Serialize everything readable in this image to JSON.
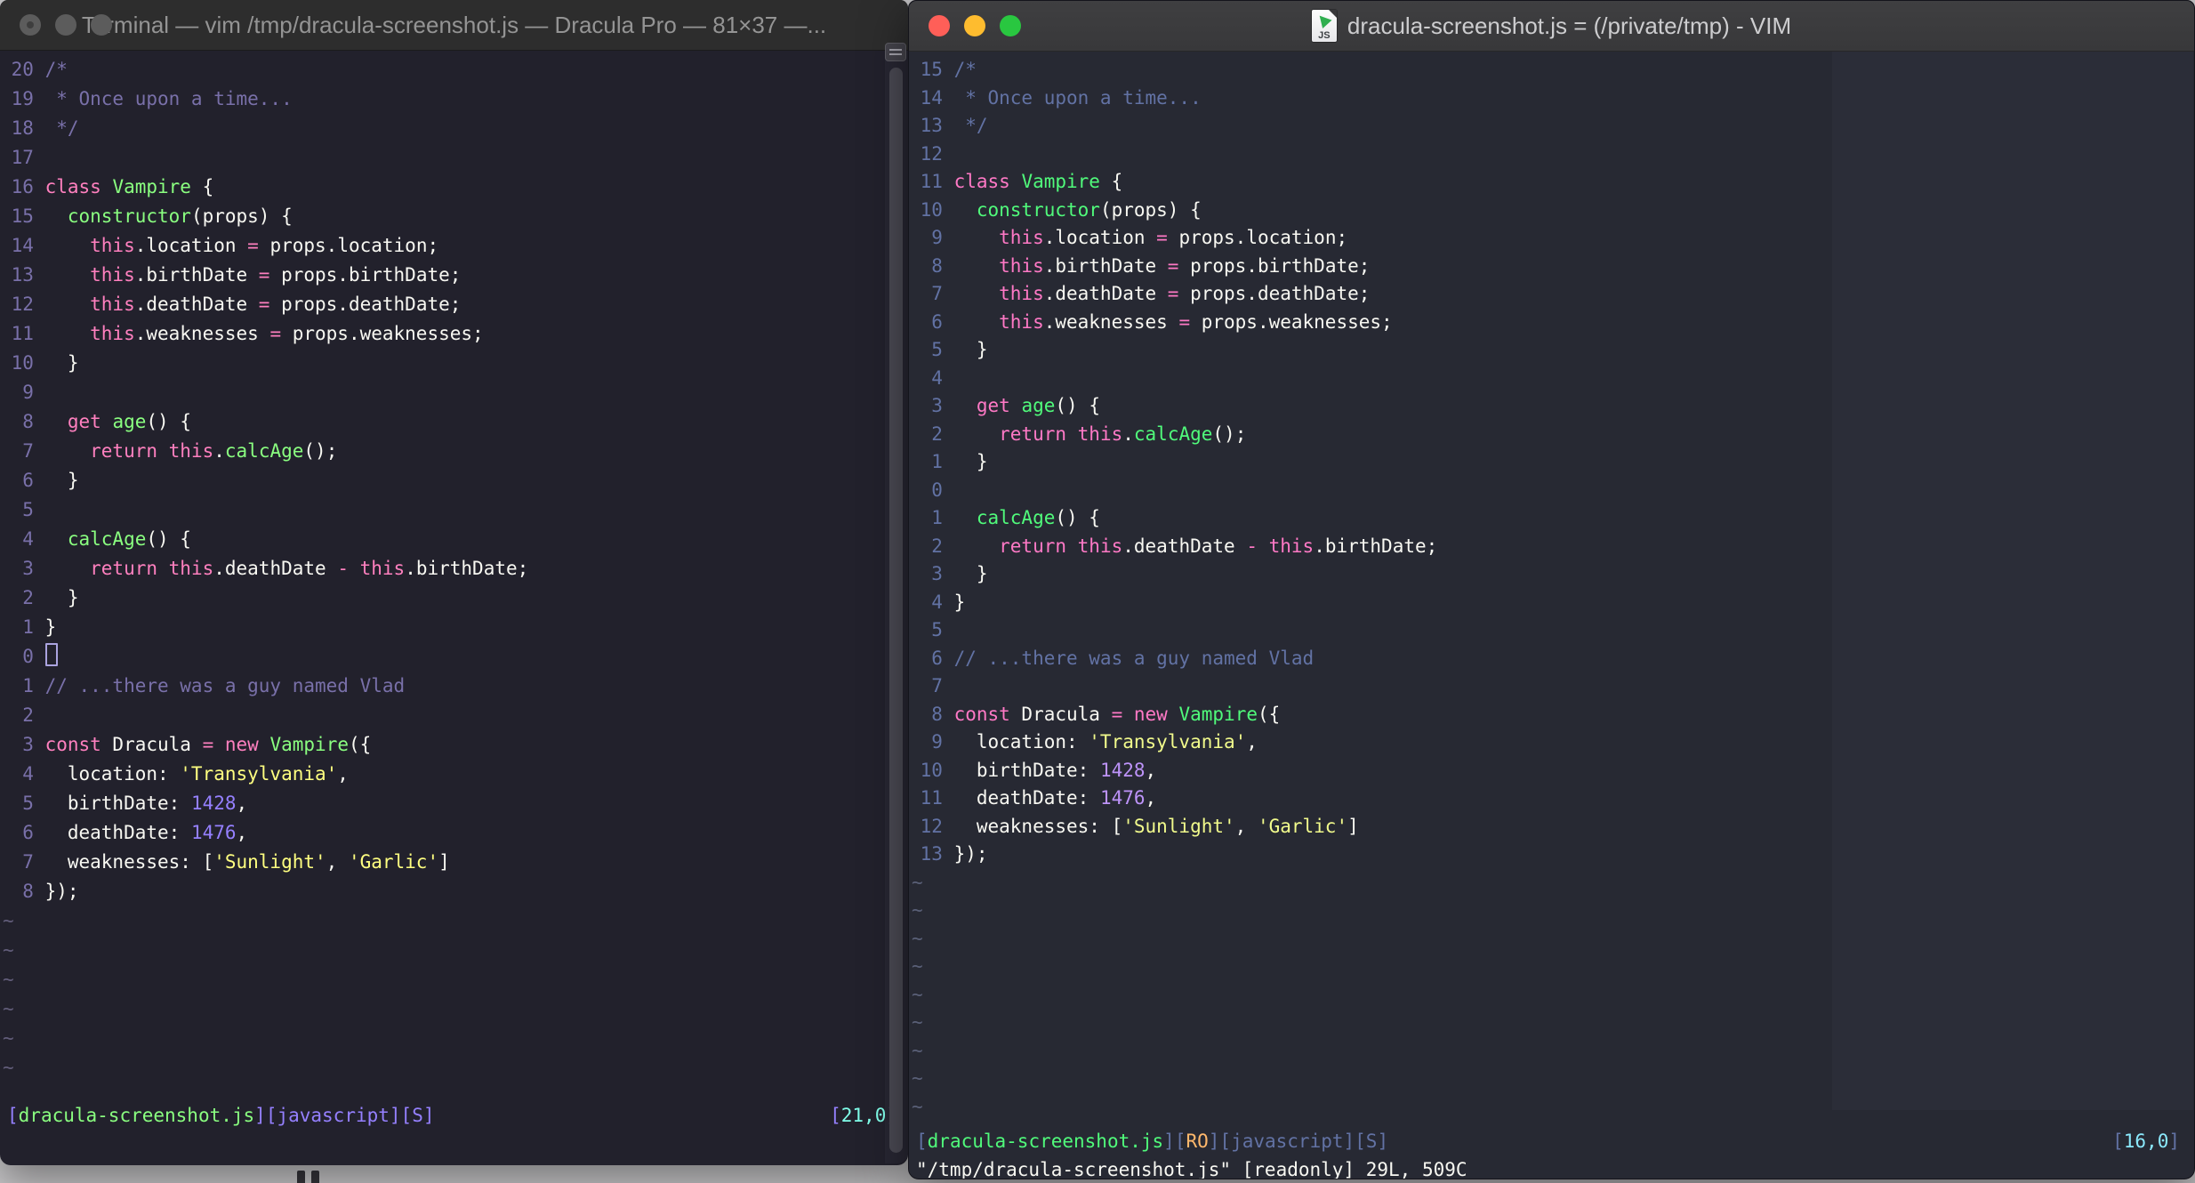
{
  "shared_code": [
    {
      "t": [
        [
          "c",
          "/*"
        ]
      ]
    },
    {
      "t": [
        [
          "c",
          " * Once upon a time..."
        ]
      ]
    },
    {
      "t": [
        [
          "c",
          " */"
        ]
      ]
    },
    {
      "t": []
    },
    {
      "t": [
        [
          "p",
          "class"
        ],
        [
          "fg",
          " "
        ],
        [
          "g",
          "Vampire"
        ],
        [
          "fg",
          " {"
        ]
      ]
    },
    {
      "t": [
        [
          "fg",
          "  "
        ],
        [
          "g",
          "constructor"
        ],
        [
          "fg",
          "(props) {"
        ]
      ]
    },
    {
      "t": [
        [
          "fg",
          "    "
        ],
        [
          "p",
          "this"
        ],
        [
          "fg",
          ".location "
        ],
        [
          "p",
          "="
        ],
        [
          "fg",
          " props.location;"
        ]
      ]
    },
    {
      "t": [
        [
          "fg",
          "    "
        ],
        [
          "p",
          "this"
        ],
        [
          "fg",
          ".birthDate "
        ],
        [
          "p",
          "="
        ],
        [
          "fg",
          " props.birthDate;"
        ]
      ]
    },
    {
      "t": [
        [
          "fg",
          "    "
        ],
        [
          "p",
          "this"
        ],
        [
          "fg",
          ".deathDate "
        ],
        [
          "p",
          "="
        ],
        [
          "fg",
          " props.deathDate;"
        ]
      ]
    },
    {
      "t": [
        [
          "fg",
          "    "
        ],
        [
          "p",
          "this"
        ],
        [
          "fg",
          ".weaknesses "
        ],
        [
          "p",
          "="
        ],
        [
          "fg",
          " props.weaknesses;"
        ]
      ]
    },
    {
      "t": [
        [
          "fg",
          "  }"
        ]
      ]
    },
    {
      "t": []
    },
    {
      "t": [
        [
          "fg",
          "  "
        ],
        [
          "p",
          "get"
        ],
        [
          "fg",
          " "
        ],
        [
          "g",
          "age"
        ],
        [
          "fg",
          "() {"
        ]
      ]
    },
    {
      "t": [
        [
          "fg",
          "    "
        ],
        [
          "p",
          "return"
        ],
        [
          "fg",
          " "
        ],
        [
          "p",
          "this"
        ],
        [
          "fg",
          "."
        ],
        [
          "g",
          "calcAge"
        ],
        [
          "fg",
          "();"
        ]
      ]
    },
    {
      "t": [
        [
          "fg",
          "  }"
        ]
      ]
    },
    {
      "t": []
    },
    {
      "t": [
        [
          "fg",
          "  "
        ],
        [
          "g",
          "calcAge"
        ],
        [
          "fg",
          "() {"
        ]
      ]
    },
    {
      "t": [
        [
          "fg",
          "    "
        ],
        [
          "p",
          "return"
        ],
        [
          "fg",
          " "
        ],
        [
          "p",
          "this"
        ],
        [
          "fg",
          ".deathDate "
        ],
        [
          "p",
          "-"
        ],
        [
          "fg",
          " "
        ],
        [
          "p",
          "this"
        ],
        [
          "fg",
          ".birthDate;"
        ]
      ]
    },
    {
      "t": [
        [
          "fg",
          "  }"
        ]
      ]
    },
    {
      "t": [
        [
          "fg",
          "}"
        ]
      ]
    },
    {
      "t": []
    },
    {
      "t": [
        [
          "c",
          "// ...there was a guy named Vlad"
        ]
      ]
    },
    {
      "t": []
    },
    {
      "t": [
        [
          "p",
          "const"
        ],
        [
          "fg",
          " Dracula "
        ],
        [
          "p",
          "="
        ],
        [
          "fg",
          " "
        ],
        [
          "p",
          "new"
        ],
        [
          "fg",
          " "
        ],
        [
          "g",
          "Vampire"
        ],
        [
          "fg",
          "({"
        ]
      ]
    },
    {
      "t": [
        [
          "fg",
          "  location: "
        ],
        [
          "y",
          "'Transylvania'"
        ],
        [
          "fg",
          ","
        ]
      ]
    },
    {
      "t": [
        [
          "fg",
          "  birthDate: "
        ],
        [
          "pu",
          "1428"
        ],
        [
          "fg",
          ","
        ]
      ]
    },
    {
      "t": [
        [
          "fg",
          "  deathDate: "
        ],
        [
          "pu",
          "1476"
        ],
        [
          "fg",
          ","
        ]
      ]
    },
    {
      "t": [
        [
          "fg",
          "  weaknesses: ["
        ],
        [
          "y",
          "'Sunlight'"
        ],
        [
          "fg",
          ", "
        ],
        [
          "y",
          "'Garlic'"
        ],
        [
          "fg",
          "]"
        ]
      ]
    },
    {
      "t": [
        [
          "fg",
          "});"
        ]
      ]
    }
  ],
  "left_window": {
    "title": "Terminal — vim /tmp/dracula-screenshot.js — Dracula Pro — 81×37 —...",
    "theme": {
      "bg": "#22212C",
      "fg": "#F8F8F2",
      "comment": "#7970A9",
      "pink": "#FF80BF",
      "green": "#8AFF80",
      "purple": "#9580FF",
      "yellow": "#FFFF80",
      "cyan": "#80FFEA",
      "orange": "#FFCA80",
      "line_number": "#7970A9",
      "tilde": "#625D7A",
      "titlebar_bg": "#2D2D2D",
      "title_fg": "#949494"
    },
    "traffic_lights": {
      "close": "#5C5C5C",
      "minimize": "#5C5C5C",
      "zoom": "#5C5C5C"
    },
    "numbers": [
      "20",
      "19",
      "18",
      "17",
      "16",
      "15",
      "14",
      "13",
      "12",
      "11",
      "10",
      "9",
      "8",
      "7",
      "6",
      "5",
      "4",
      "3",
      "2",
      "1",
      "0",
      "1",
      "2",
      "3",
      "4",
      "5",
      "6",
      "7",
      "8"
    ],
    "cursor_line_index": 20,
    "tilde_count": 6,
    "status_left_tokens": [
      [
        "pu",
        "["
      ],
      [
        "g",
        "dracula-screenshot.js"
      ],
      [
        "pu",
        "]["
      ],
      [
        "pu",
        "javascript"
      ],
      [
        "pu",
        "]["
      ],
      [
        "pu",
        "S"
      ],
      [
        "pu",
        "]"
      ]
    ],
    "status_right_tokens": [
      [
        "pu",
        "["
      ],
      [
        "cy",
        "21,0"
      ],
      [
        "pu",
        "]"
      ]
    ],
    "command_line": ""
  },
  "right_window": {
    "title": "dracula-screenshot.js = (/private/tmp) - VIM",
    "doc_icon_label": "JS",
    "theme": {
      "bg": "#272933",
      "fg": "#F8F8F2",
      "comment": "#6272A4",
      "pink": "#FF79C6",
      "green": "#50FA7B",
      "purple": "#BD93F9",
      "yellow": "#F1FA8C",
      "cyan": "#8BE9FD",
      "orange": "#FFB86C",
      "line_number": "#6272A4",
      "tilde": "#5A6078",
      "titlebar_bg": "#3A3A3C",
      "title_fg": "#CDCDCF",
      "filler": "#2B2D38"
    },
    "traffic_lights": {
      "close": "#FF5F58",
      "minimize": "#FEBC2F",
      "zoom": "#29C740"
    },
    "numbers": [
      "15",
      "14",
      "13",
      "12",
      "11",
      "10",
      "9",
      "8",
      "7",
      "6",
      "5",
      "4",
      "3",
      "2",
      "1",
      "0",
      "1",
      "2",
      "3",
      "4",
      "5",
      "6",
      "7",
      "8",
      "9",
      "10",
      "11",
      "12",
      "13"
    ],
    "cursor_line_index": -1,
    "tilde_count": 9,
    "status_left_tokens": [
      [
        "c",
        "["
      ],
      [
        "g",
        "dracula-screenshot.js"
      ],
      [
        "c",
        "]["
      ],
      [
        "o",
        "RO"
      ],
      [
        "c",
        "]["
      ],
      [
        "c",
        "javascript"
      ],
      [
        "c",
        "]["
      ],
      [
        "c",
        "S"
      ],
      [
        "c",
        "]"
      ]
    ],
    "status_right_tokens": [
      [
        "c",
        "["
      ],
      [
        "cy",
        "16,0"
      ],
      [
        "c",
        "]"
      ]
    ],
    "command_line": "\"/tmp/dracula-screenshot.js\" [readonly] 29L, 509C"
  }
}
